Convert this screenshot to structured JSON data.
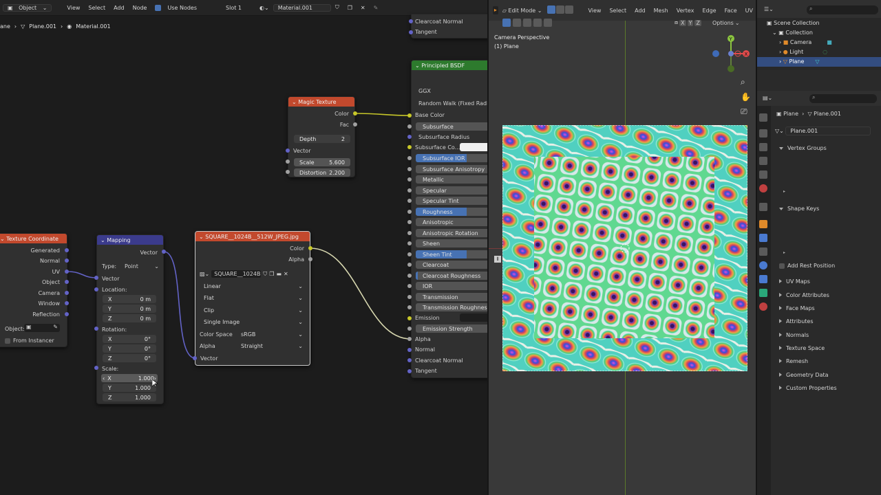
{
  "node_editor": {
    "menubar": {
      "mode": "Object",
      "menus": [
        "View",
        "Select",
        "Add",
        "Node"
      ],
      "use_nodes_label": "Use Nodes",
      "slot": "Slot 1",
      "material": "Material.001"
    },
    "breadcrumb": {
      "object": "ane",
      "mesh": "Plane.001",
      "material": "Material.001"
    },
    "texture_coordinate": {
      "title": "Texture Coordinate",
      "outputs": [
        "Generated",
        "Normal",
        "UV",
        "Object",
        "Camera",
        "Window",
        "Reflection"
      ],
      "object_label": "Object:",
      "from_instancer": "From Instancer"
    },
    "mapping": {
      "title": "Mapping",
      "output": "Vector",
      "type_label": "Type:",
      "type_value": "Point",
      "input_vector": "Vector",
      "location_label": "Location:",
      "location": [
        {
          "axis": "X",
          "value": "0 m"
        },
        {
          "axis": "Y",
          "value": "0 m"
        },
        {
          "axis": "Z",
          "value": "0 m"
        }
      ],
      "rotation_label": "Rotation:",
      "rotation": [
        {
          "axis": "X",
          "value": "0°"
        },
        {
          "axis": "Y",
          "value": "0°"
        },
        {
          "axis": "Z",
          "value": "0°"
        }
      ],
      "scale_label": "Scale:",
      "scale": [
        {
          "axis": "X",
          "value": "1.000"
        },
        {
          "axis": "Y",
          "value": "1.000"
        },
        {
          "axis": "Z",
          "value": "1.000"
        }
      ]
    },
    "magic_texture": {
      "title": "Magic Texture",
      "out_color": "Color",
      "out_fac": "Fac",
      "depth_label": "Depth",
      "depth_value": "2",
      "in_vector": "Vector",
      "scale_label": "Scale",
      "scale_value": "5.600",
      "distortion_label": "Distortion",
      "distortion_value": "2.200"
    },
    "image_texture": {
      "title": "SQUARE__1024B__512W_JPEG.jpg",
      "out_color": "Color",
      "out_alpha": "Alpha",
      "image_name": "SQUARE__1024B...",
      "interpolation": "Linear",
      "projection": "Flat",
      "extension": "Clip",
      "source": "Single Image",
      "color_space_label": "Color Space",
      "color_space_value": "sRGB",
      "alpha_label": "Alpha",
      "alpha_value": "Straight",
      "in_vector": "Vector"
    },
    "top_partial": {
      "clearcoat_normal": "Clearcoat Normal",
      "tangent": "Tangent"
    },
    "principled": {
      "title": "Principled BSDF",
      "distribution": "GGX",
      "subsurface_method": "Random Walk (Fixed Radius)",
      "base_color": "Base Color",
      "subsurface": "Subsurface",
      "subsurface_radius": "Subsurface Radius",
      "subsurface_color": "Subsurface Co...",
      "subsurface_ior": "Subsurface IOR",
      "subsurface_anisotropy": "Subsurface Anisotropy",
      "metallic": "Metallic",
      "specular": "Specular",
      "specular_tint": "Specular Tint",
      "roughness": "Roughness",
      "anisotropic": "Anisotropic",
      "anisotropic_rotation": "Anisotropic Rotation",
      "sheen": "Sheen",
      "sheen_tint": "Sheen Tint",
      "clearcoat": "Clearcoat",
      "clearcoat_roughness": "Clearcoat Roughness",
      "ior": "IOR",
      "transmission": "Transmission",
      "transmission_roughness": "Transmission Roughness",
      "emission": "Emission",
      "emission_strength": "Emission Strength",
      "alpha": "Alpha",
      "normal": "Normal",
      "clearcoat_normal": "Clearcoat Normal",
      "tangent": "Tangent"
    }
  },
  "viewport": {
    "mode": "Edit Mode",
    "menus": [
      "View",
      "Select",
      "Add",
      "Mesh",
      "Vertex",
      "Edge",
      "Face",
      "UV"
    ],
    "options": "Options",
    "camera_label": "Camera Perspective",
    "object_label": "(1) Plane",
    "axes": {
      "x": "X",
      "y": "Y",
      "z": "Z"
    }
  },
  "outliner": {
    "scene_collection": "Scene Collection",
    "collection": "Collection",
    "items": [
      "Camera",
      "Light",
      "Plane"
    ]
  },
  "properties": {
    "breadcrumb_object": "Plane",
    "breadcrumb_mesh": "Plane.001",
    "mesh_name": "Plane.001",
    "sections": {
      "vertex_groups": "Vertex Groups",
      "shape_keys": "Shape Keys",
      "add_rest_position": "Add Rest Position",
      "uv_maps": "UV Maps",
      "color_attributes": "Color Attributes",
      "face_maps": "Face Maps",
      "attributes": "Attributes",
      "normals": "Normals",
      "texture_space": "Texture Space",
      "remesh": "Remesh",
      "geometry_data": "Geometry Data",
      "custom_properties": "Custom Properties"
    }
  },
  "colors": {
    "accent_blue": "#4772b3",
    "socket_yellow": "#c7c729",
    "socket_grey": "#a1a1a1",
    "socket_purple": "#6363c7",
    "header_texture": "#c2492d",
    "header_vector": "#3b3b8c",
    "header_shader": "#2d7a2d"
  }
}
